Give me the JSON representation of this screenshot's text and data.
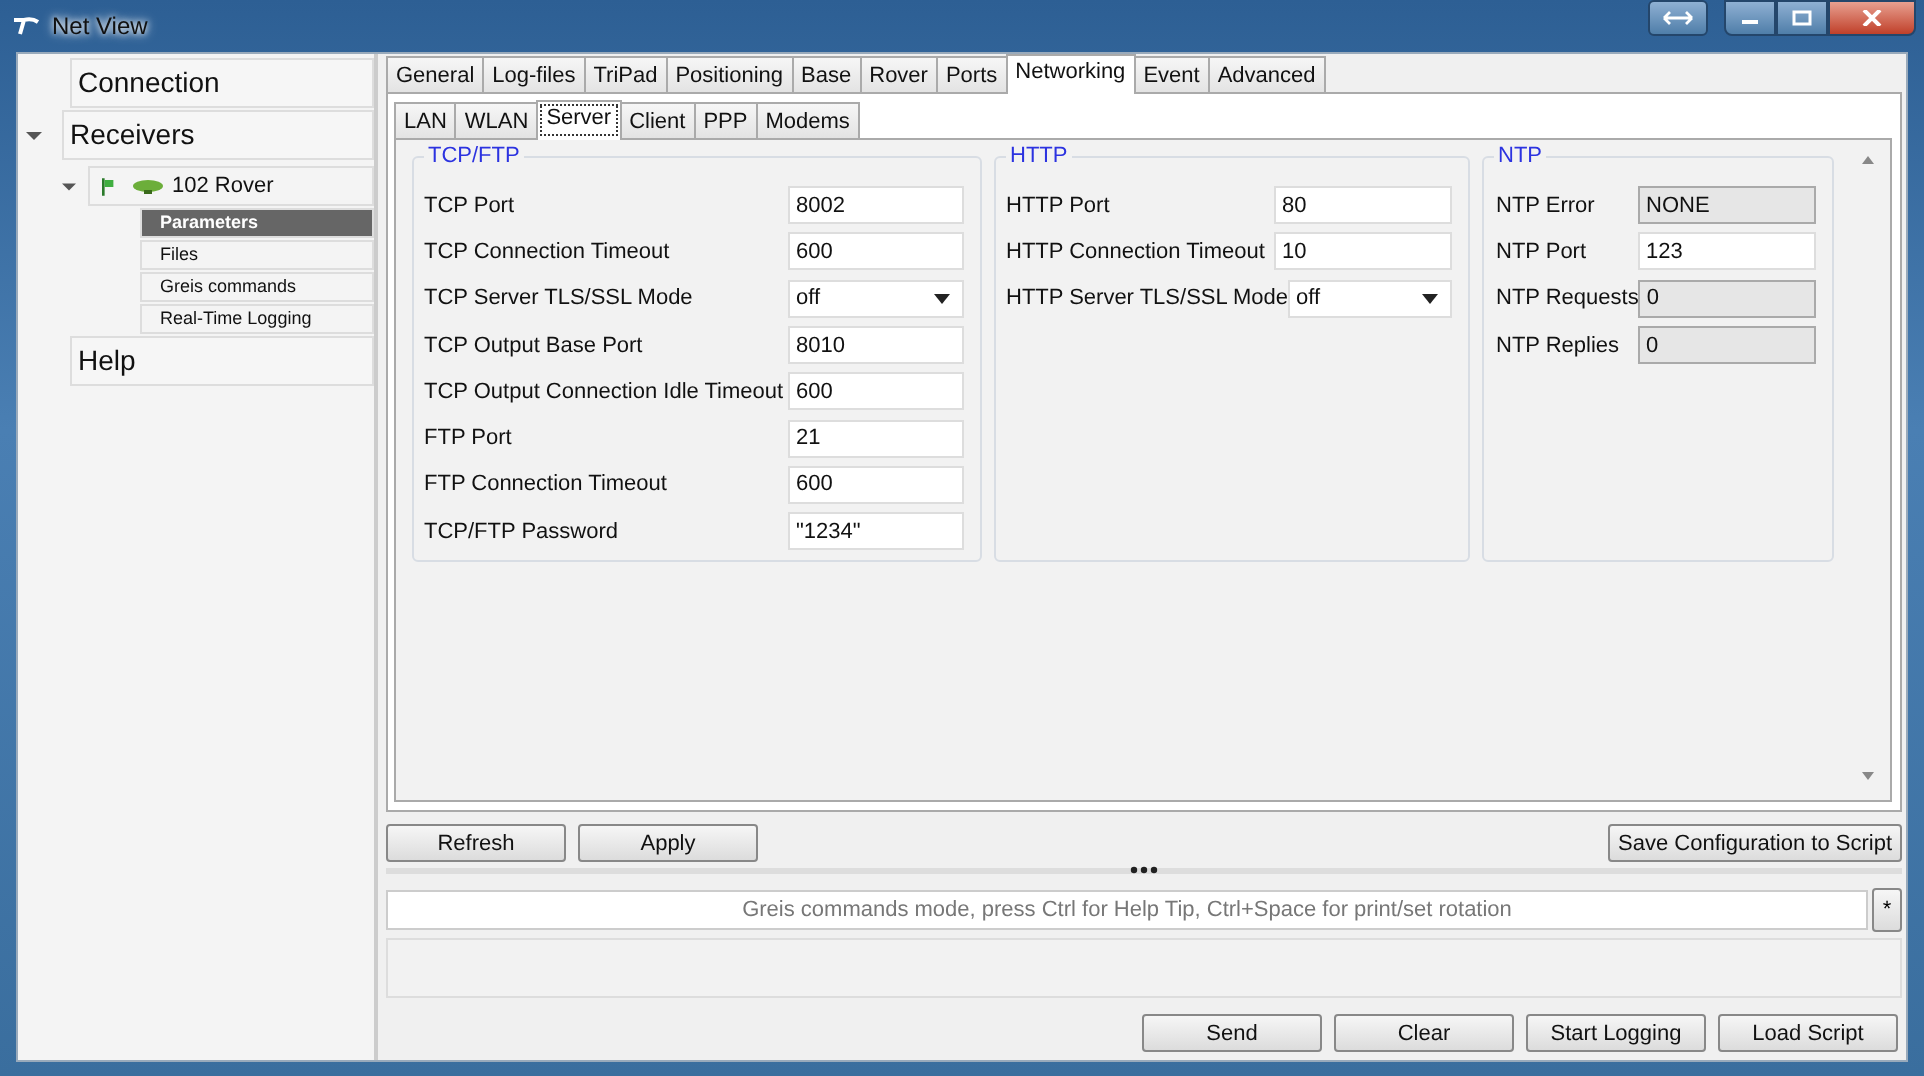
{
  "window": {
    "title": "Net View"
  },
  "sidebar": {
    "connection": {
      "label": "Connection"
    },
    "receivers": {
      "label": "Receivers",
      "expanded": true,
      "items": [
        {
          "label": "102 Rover",
          "expanded": true,
          "children": [
            {
              "label": "Parameters",
              "selected": true
            },
            {
              "label": "Files",
              "selected": false
            },
            {
              "label": "Greis commands",
              "selected": false
            },
            {
              "label": "Real-Time Logging",
              "selected": false
            }
          ]
        }
      ]
    },
    "help": {
      "label": "Help"
    }
  },
  "tabs": [
    {
      "label": "General",
      "selected": false
    },
    {
      "label": "Log-files",
      "selected": false
    },
    {
      "label": "TriPad",
      "selected": false
    },
    {
      "label": "Positioning",
      "selected": false
    },
    {
      "label": "Base",
      "selected": false
    },
    {
      "label": "Rover",
      "selected": false
    },
    {
      "label": "Ports",
      "selected": false
    },
    {
      "label": "Networking",
      "selected": true
    },
    {
      "label": "Event",
      "selected": false
    },
    {
      "label": "Advanced",
      "selected": false
    }
  ],
  "subtabs": [
    {
      "label": "LAN",
      "selected": false
    },
    {
      "label": "WLAN",
      "selected": false
    },
    {
      "label": "Server",
      "selected": true
    },
    {
      "label": "Client",
      "selected": false
    },
    {
      "label": "PPP",
      "selected": false
    },
    {
      "label": "Modems",
      "selected": false
    }
  ],
  "groups": [
    {
      "title": "TCP/FTP",
      "fields": [
        {
          "label": "TCP Port",
          "kind": "text",
          "value": "8002"
        },
        {
          "label": "TCP Connection Timeout",
          "kind": "text",
          "value": "600"
        },
        {
          "label": "TCP Server TLS/SSL Mode",
          "kind": "combo",
          "value": "off"
        },
        {
          "label": "TCP Output Base Port",
          "kind": "text",
          "value": "8010"
        },
        {
          "label": "TCP Output Connection Idle Timeout",
          "kind": "text",
          "value": "600"
        },
        {
          "label": "FTP Port",
          "kind": "text",
          "value": "21"
        },
        {
          "label": "FTP Connection Timeout",
          "kind": "text",
          "value": "600"
        },
        {
          "label": "TCP/FTP Password",
          "kind": "text",
          "value": "\"1234\""
        }
      ]
    },
    {
      "title": "HTTP",
      "fields": [
        {
          "label": "HTTP Port",
          "kind": "text",
          "value": "80"
        },
        {
          "label": "HTTP Connection Timeout",
          "kind": "text",
          "value": "10"
        },
        {
          "label": "HTTP Server TLS/SSL Mode",
          "kind": "combo",
          "value": "off"
        }
      ]
    },
    {
      "title": "NTP",
      "fields": [
        {
          "label": "NTP Error",
          "kind": "readonly",
          "value": "NONE"
        },
        {
          "label": "NTP Port",
          "kind": "text",
          "value": "123"
        },
        {
          "label": "NTP Requests",
          "kind": "readonly",
          "value": "0"
        },
        {
          "label": "NTP Replies",
          "kind": "readonly",
          "value": "0"
        }
      ]
    }
  ],
  "action_buttons": [
    "Refresh",
    "Apply"
  ],
  "save_button": "Save Configuration to Script",
  "command": {
    "placeholder": "Greis commands mode, press Ctrl for Help Tip, Ctrl+Space for print/set rotation",
    "star_button": "*"
  },
  "bottom_buttons": [
    "Send",
    "Clear",
    "Start Logging",
    "Load Script"
  ]
}
